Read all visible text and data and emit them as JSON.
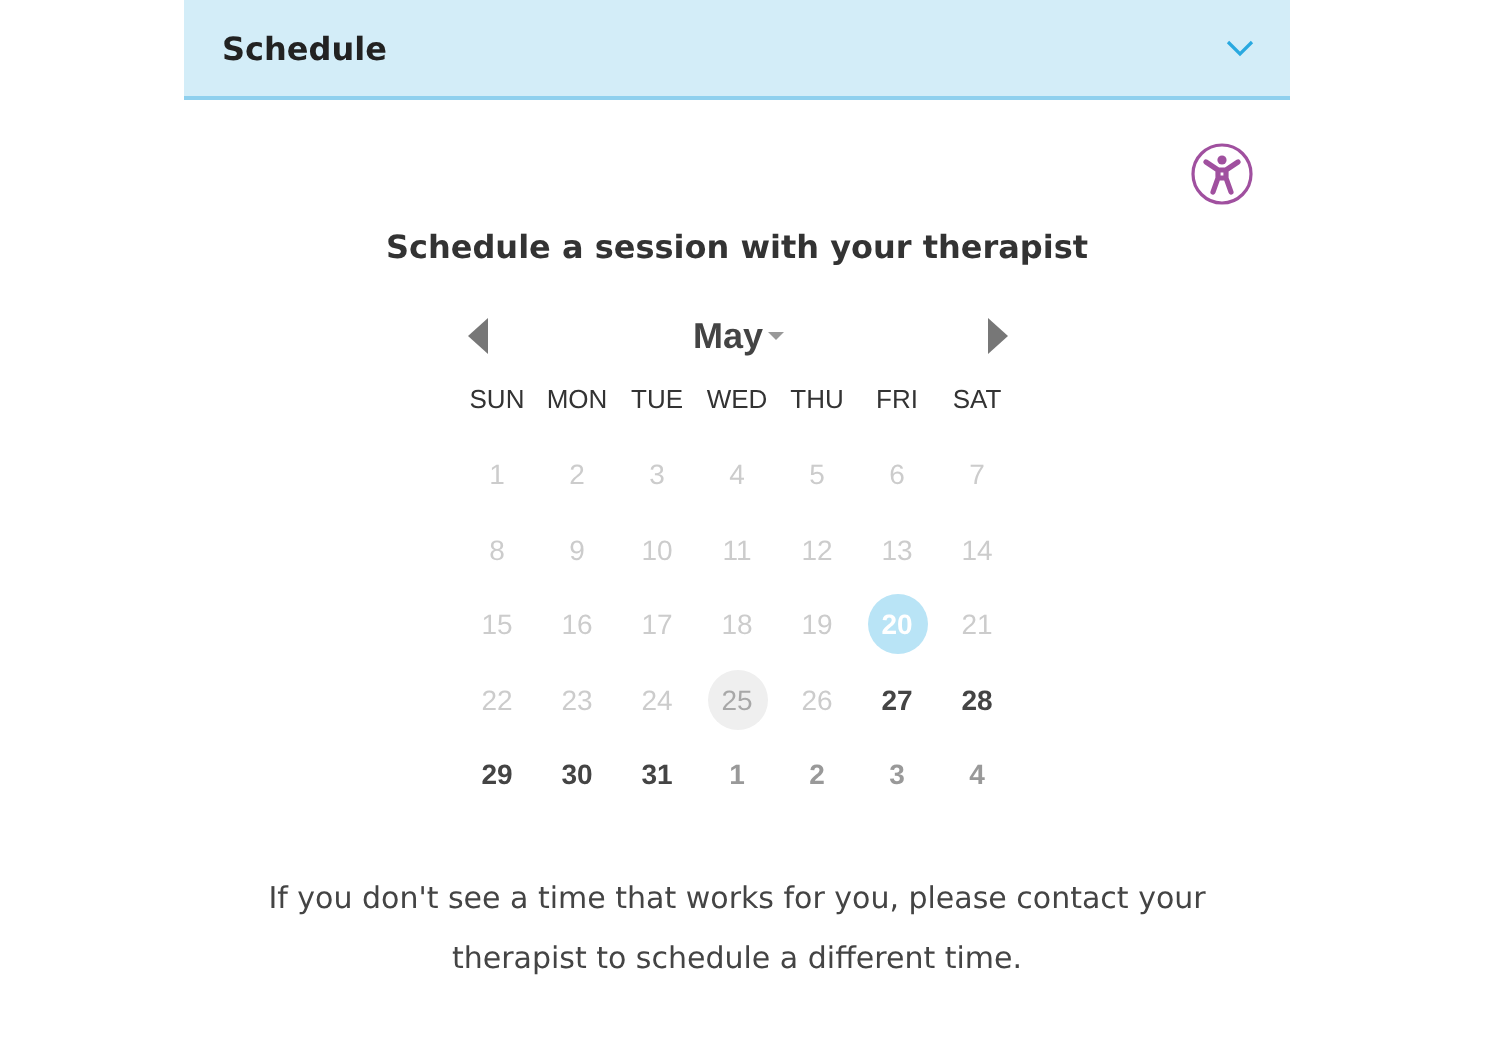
{
  "header": {
    "title": "Schedule",
    "expanded": true
  },
  "heading": "Schedule a session with your therapist",
  "calendar": {
    "month": "May",
    "weekdays": [
      "SUN",
      "MON",
      "TUE",
      "WED",
      "THU",
      "FRI",
      "SAT"
    ],
    "days": [
      {
        "label": "1",
        "kind": "past",
        "selected": false
      },
      {
        "label": "2",
        "kind": "past",
        "selected": false
      },
      {
        "label": "3",
        "kind": "past",
        "selected": false
      },
      {
        "label": "4",
        "kind": "past",
        "selected": false
      },
      {
        "label": "5",
        "kind": "past",
        "selected": false
      },
      {
        "label": "6",
        "kind": "past",
        "selected": false
      },
      {
        "label": "7",
        "kind": "past",
        "selected": false
      },
      {
        "label": "8",
        "kind": "past",
        "selected": false
      },
      {
        "label": "9",
        "kind": "past",
        "selected": false
      },
      {
        "label": "10",
        "kind": "past",
        "selected": false
      },
      {
        "label": "11",
        "kind": "past",
        "selected": false
      },
      {
        "label": "12",
        "kind": "past",
        "selected": false
      },
      {
        "label": "13",
        "kind": "past",
        "selected": false
      },
      {
        "label": "14",
        "kind": "past",
        "selected": false
      },
      {
        "label": "15",
        "kind": "past",
        "selected": false
      },
      {
        "label": "16",
        "kind": "past",
        "selected": false
      },
      {
        "label": "17",
        "kind": "past",
        "selected": false
      },
      {
        "label": "18",
        "kind": "past",
        "selected": false
      },
      {
        "label": "19",
        "kind": "past",
        "selected": false
      },
      {
        "label": "20",
        "kind": "available",
        "selected": true
      },
      {
        "label": "21",
        "kind": "past",
        "selected": false
      },
      {
        "label": "22",
        "kind": "past",
        "selected": false
      },
      {
        "label": "23",
        "kind": "past",
        "selected": false
      },
      {
        "label": "24",
        "kind": "past",
        "selected": false
      },
      {
        "label": "25",
        "kind": "today",
        "selected": false
      },
      {
        "label": "26",
        "kind": "past",
        "selected": false
      },
      {
        "label": "27",
        "kind": "available",
        "selected": false
      },
      {
        "label": "28",
        "kind": "available",
        "selected": false
      },
      {
        "label": "29",
        "kind": "available",
        "selected": false
      },
      {
        "label": "30",
        "kind": "available",
        "selected": false
      },
      {
        "label": "31",
        "kind": "available",
        "selected": false
      },
      {
        "label": "1",
        "kind": "next-month",
        "selected": false
      },
      {
        "label": "2",
        "kind": "next-month",
        "selected": false
      },
      {
        "label": "3",
        "kind": "next-month",
        "selected": false
      },
      {
        "label": "4",
        "kind": "next-month",
        "selected": false
      }
    ]
  },
  "note": "If you don't see a time that works for you, please contact your therapist to schedule a different time."
}
